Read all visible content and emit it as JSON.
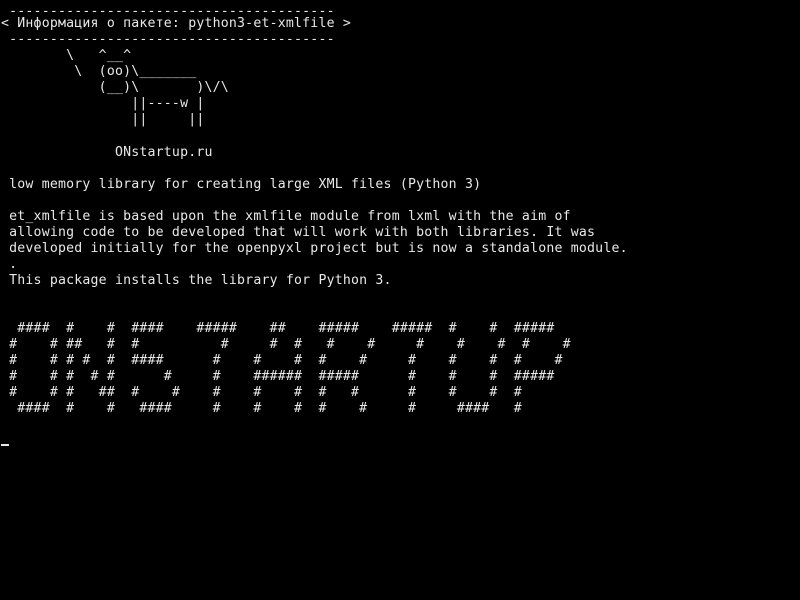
{
  "cowsay": {
    "border_top": " ----------------------------------------",
    "bubble_text": "< Информация о пакете: python3-et-xmlfile >",
    "border_bottom": " ----------------------------------------",
    "cow": [
      "        \\   ^__^",
      "         \\  (oo)\\_______",
      "            (__)\\       )\\/\\",
      "                ||----w |",
      "                ||     ||"
    ],
    "site": "              ONstartup.ru"
  },
  "package": {
    "summary": " low memory library for creating large XML files (Python 3)",
    "description": [
      " et_xmlfile is based upon the xmlfile module from lxml with the aim of",
      " allowing code to be developed that will work with both libraries. It was",
      " developed initially for the openpyxl project but is now a standalone module.",
      " .",
      " This package installs the library for Python 3."
    ]
  },
  "banner": {
    "lines": [
      "  ####  #    #  ####    #####    ##    #####    #####  #    #  #####",
      " #    # ##   #  #          #     #  #   #    #     #    #    #  #    #",
      " #    # # #  #  ####      #    #    #  #    #     #    #    #  #    #",
      " #    # #  # #      #     #    ######  #####      #    #    #  #####",
      " #    # #   ##  #    #    #    #    #  #   #      #    #    #  #",
      "  ####  #    #   ####     #    #    #  #    #     #     ####   #"
    ]
  }
}
